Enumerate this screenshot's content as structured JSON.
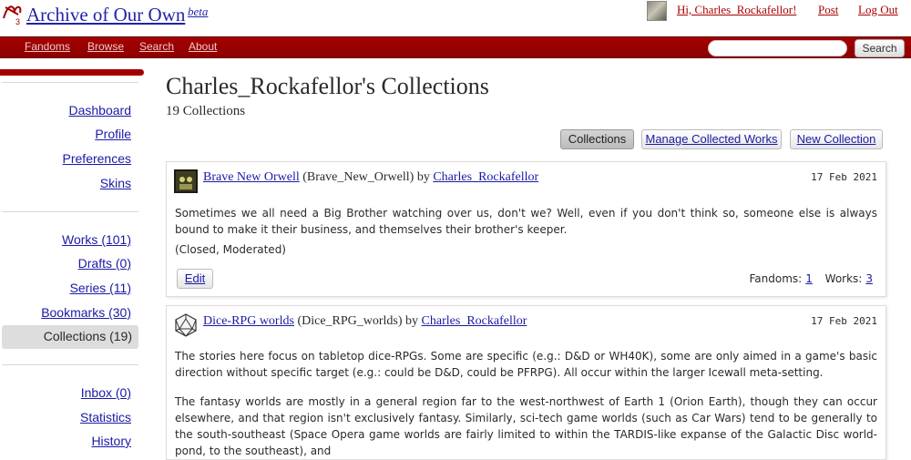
{
  "header": {
    "site_title": "Archive of Our Own",
    "beta": "beta",
    "greeting": "Hi, Charles_Rockafellor!",
    "post": "Post",
    "logout": "Log Out",
    "logo_icon": "ao3-logo-icon",
    "logo_text": "3"
  },
  "nav": {
    "items": [
      "Fandoms",
      "Browse",
      "Search",
      "About"
    ],
    "search_placeholder": "",
    "search_button": "Search"
  },
  "sidebar": {
    "group1": [
      "Dashboard",
      "Profile",
      "Preferences",
      "Skins"
    ],
    "group2": [
      "Works (101)",
      "Drafts (0)",
      "Series (11)",
      "Bookmarks (30)",
      "Collections (19)"
    ],
    "group3": [
      "Inbox (0)",
      "Statistics",
      "History"
    ]
  },
  "main": {
    "title": "Charles_Rockafellor's Collections",
    "count": "19 Collections",
    "actions": [
      "Collections",
      "Manage Collected Works",
      "New Collection"
    ]
  },
  "collections": [
    {
      "title": "Brave New Orwell",
      "name": "(Brave_New_Orwell) by",
      "owner": "Charles_Rockafellor",
      "date": "17 Feb 2021",
      "icon": "big-brother-icon",
      "description": "Sometimes we all need a Big Brother watching over us, don't we?  Well, even if you don't think so, someone else is always bound to make it their business, and themselves their brother's keeper.",
      "status": "(Closed, Moderated)",
      "edit": "Edit",
      "fandoms_label": "Fandoms:",
      "fandoms": "1",
      "works_label": "Works:",
      "works": "3"
    },
    {
      "title": "Dice-RPG worlds",
      "name": "(Dice_RPG_worlds) by",
      "owner": "Charles_Rockafellor",
      "date": "17 Feb 2021",
      "icon": "d20-dice-icon",
      "description": "The stories here focus on tabletop dice-RPGs.  Some are specific (e.g.: D&D or WH40K), some are only aimed in a game's basic direction without specific target (e.g.: could be D&D, could be PFRPG).  All occur within the larger Icewall meta-setting.",
      "description2": "The fantasy worlds are mostly in a general region far to the west-northwest of Earth 1 (Orion Earth), though they can occur elsewhere, and that region isn't exclusively fantasy.  Similarly, sci-tech game worlds (such as Car Wars) tend to be generally to the south-southeast (Space Opera game worlds are fairly limited to within the TARDIS-like expanse of the Galactic Disc world-pond, to the southeast), and"
    }
  ]
}
